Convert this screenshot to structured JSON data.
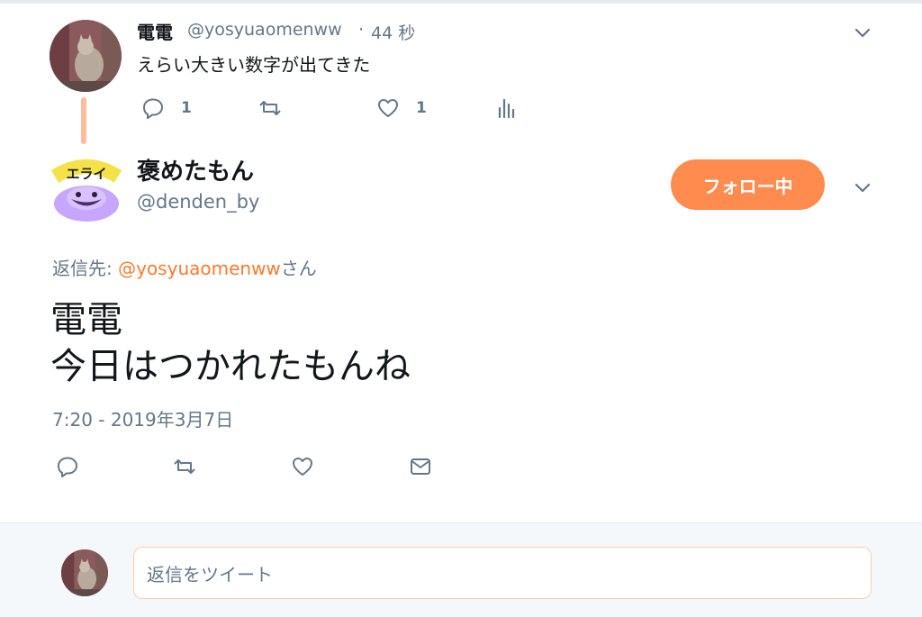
{
  "parent_tweet": {
    "author_name": "電電",
    "author_handle": "@yosyuaomenww",
    "separator": "·",
    "time_ago": "44 秒",
    "text": "えらい大きい数字が出てきた",
    "reply_count": "1",
    "like_count": "1"
  },
  "main_tweet": {
    "author_name": "褒めたもん",
    "author_handle": "@denden_by",
    "follow_label": "フォロー中",
    "reply_to_prefix": "返信先: ",
    "reply_to_mention": "@yosyuaomenww",
    "reply_to_suffix": "さん",
    "text_line1": "電電",
    "text_line2": "今日はつかれたもんね",
    "timestamp": "7:20 - 2019年3月7日",
    "avatar_text": "エライ"
  },
  "reply_box": {
    "placeholder": "返信をツイート"
  },
  "colors": {
    "accent": "#ff8b4e",
    "mention": "#ff7a2e",
    "thread_line": "#ffbd9e",
    "muted": "#657786"
  },
  "icons": [
    "reply-icon",
    "retweet-icon",
    "like-icon",
    "analytics-icon",
    "dm-icon",
    "chevron-down-icon"
  ]
}
